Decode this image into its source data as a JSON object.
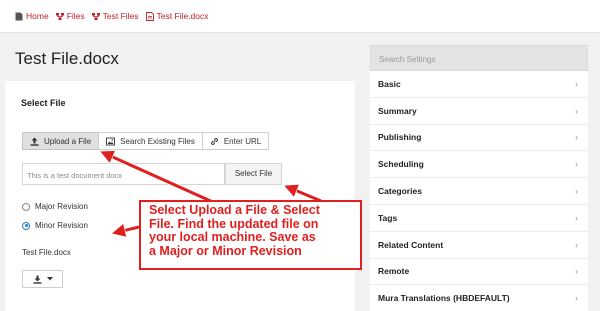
{
  "breadcrumb": [
    {
      "label": "Home",
      "icon": "page-icon"
    },
    {
      "label": "Files",
      "icon": "hierarchy-icon"
    },
    {
      "label": "Test Files",
      "icon": "hierarchy-icon"
    },
    {
      "label": "Test File.docx",
      "icon": "file-icon"
    }
  ],
  "page": {
    "title": "Test File.docx"
  },
  "panel": {
    "heading": "Select File",
    "tabs": [
      "Upload a File",
      "Search Existing Files",
      "Enter URL"
    ],
    "file_input_value": "This is a test document docx",
    "select_button": "Select File",
    "radios": [
      {
        "label": "Major Revision",
        "checked": false
      },
      {
        "label": "Minor Revision",
        "checked": true
      }
    ],
    "filename": "Test File.docx"
  },
  "sidebar": {
    "search_placeholder": "Search Settings",
    "items": [
      "Basic",
      "Summary",
      "Publishing",
      "Scheduling",
      "Categories",
      "Tags",
      "Related Content",
      "Remote",
      "Mura Translations (HBDEFAULT)"
    ]
  },
  "callout": {
    "lines": [
      "Select Upload a File & Select",
      "File. Find the updated file on",
      "your local machine. Save as",
      "a Major or Minor Revision"
    ]
  },
  "colors": {
    "accent_red": "#c0212a",
    "callout_red": "#e01f1f",
    "radio_blue": "#2a78c8"
  }
}
